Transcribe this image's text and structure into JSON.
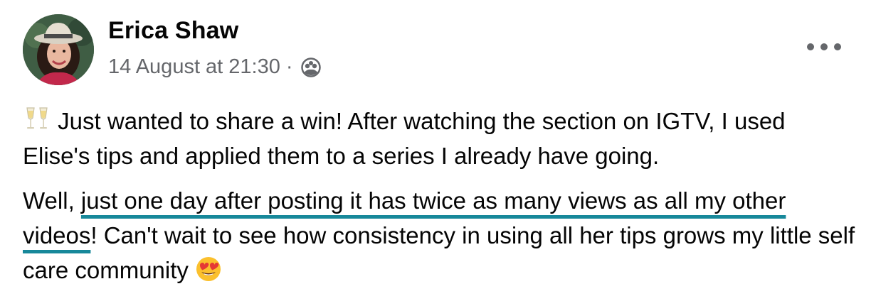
{
  "author": {
    "name": "Erica Shaw",
    "avatar_icon": "profile-photo"
  },
  "meta": {
    "timestamp": "14 August at 21:30",
    "separator": "·",
    "audience_icon": "group-members-icon"
  },
  "more_icon": "more-options-icon",
  "post": {
    "p1_emoji": "champagne-glasses-emoji",
    "p1_text": "Just wanted to share a win! After watching the section on IGTV, I used Elise's tips and applied them to a series I already have going.",
    "p2_pre": "Well, ",
    "p2_highlight": "just one day after posting it has twice as many views as all my other videos",
    "p2_post": "! Can't wait to see how consistency in using all her tips grows my little self care community",
    "p2_emoji": "heart-eyes-emoji"
  },
  "colors": {
    "highlight_underline": "#17889a",
    "meta_text": "#65676b",
    "text": "#050505"
  }
}
